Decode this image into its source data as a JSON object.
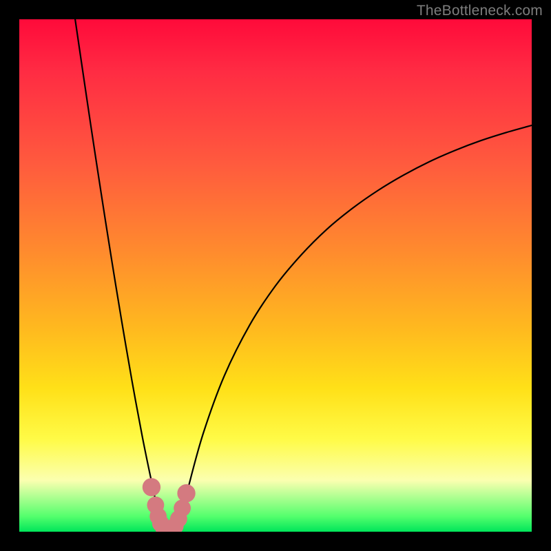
{
  "watermark": "TheBottleneck.com",
  "chart_data": {
    "type": "line",
    "title": "",
    "xlabel": "",
    "ylabel": "",
    "xlim": [
      0,
      100
    ],
    "ylim": [
      0,
      100
    ],
    "grid": false,
    "legend": false,
    "background_gradient": {
      "orientation": "vertical",
      "stops": [
        {
          "pos": 0.0,
          "color": "#ff0a3a"
        },
        {
          "pos": 0.28,
          "color": "#ff5a3e"
        },
        {
          "pos": 0.6,
          "color": "#ffb81f"
        },
        {
          "pos": 0.82,
          "color": "#fffb47"
        },
        {
          "pos": 0.97,
          "color": "#54ff6d"
        },
        {
          "pos": 1.0,
          "color": "#00e55a"
        }
      ]
    },
    "series": [
      {
        "name": "bottleneck-curve",
        "x": [
          10.9,
          12.0,
          14.0,
          16.0,
          18.0,
          20.0,
          22.0,
          24.0,
          26.0,
          27.3,
          28.7,
          30.1,
          31.8,
          33.1,
          35.9,
          40.0,
          45.0,
          50.0,
          55.0,
          60.0,
          65.0,
          70.0,
          75.0,
          80.0,
          85.0,
          90.0,
          95.0,
          100.0
        ],
        "y": [
          100.0,
          92.5,
          79.0,
          65.9,
          53.2,
          41.0,
          29.4,
          18.6,
          8.9,
          3.2,
          0.0,
          0.0,
          3.4,
          9.1,
          19.2,
          30.4,
          40.4,
          48.0,
          54.0,
          59.0,
          63.1,
          66.6,
          69.6,
          72.2,
          74.4,
          76.3,
          77.9,
          79.3
        ]
      }
    ],
    "markers": [
      {
        "x": 25.8,
        "y": 8.7,
        "r": 1.1
      },
      {
        "x": 26.6,
        "y": 5.2,
        "r": 1.0
      },
      {
        "x": 27.1,
        "y": 3.0,
        "r": 1.0
      },
      {
        "x": 27.6,
        "y": 1.6,
        "r": 1.0
      },
      {
        "x": 28.2,
        "y": 0.7,
        "r": 1.0
      },
      {
        "x": 28.9,
        "y": 0.3,
        "r": 1.0
      },
      {
        "x": 29.6,
        "y": 0.4,
        "r": 1.0
      },
      {
        "x": 30.4,
        "y": 1.1,
        "r": 1.0
      },
      {
        "x": 31.1,
        "y": 2.5,
        "r": 1.0
      },
      {
        "x": 31.8,
        "y": 4.6,
        "r": 1.0
      },
      {
        "x": 32.6,
        "y": 7.5,
        "r": 1.1
      }
    ]
  }
}
